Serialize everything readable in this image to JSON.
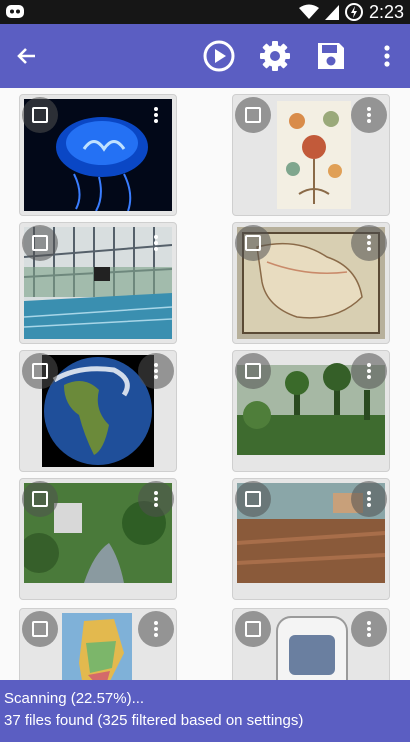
{
  "status_bar": {
    "time": "2:23"
  },
  "toolbar": {
    "back_icon": "arrow-left-icon",
    "play_icon": "play-circle-icon",
    "settings_icon": "gear-icon",
    "save_icon": "floppy-disk-icon",
    "overflow_icon": "more-vert-icon"
  },
  "colors": {
    "primary": "#5b5ec2",
    "status_bar": "#161616"
  },
  "grid": {
    "tiles": [
      {
        "subject": "jellyfish"
      },
      {
        "subject": "botanical-illustration"
      },
      {
        "subject": "indoor-pool"
      },
      {
        "subject": "old-map"
      },
      {
        "subject": "earth"
      },
      {
        "subject": "jungle"
      },
      {
        "subject": "river-gorge"
      },
      {
        "subject": "ruins"
      },
      {
        "subject": "map-lebanon"
      },
      {
        "subject": "device"
      }
    ]
  },
  "footer": {
    "scanning_text": "Scanning (22.57%)...",
    "files_text": "37 files found (325 filtered based on settings)"
  }
}
